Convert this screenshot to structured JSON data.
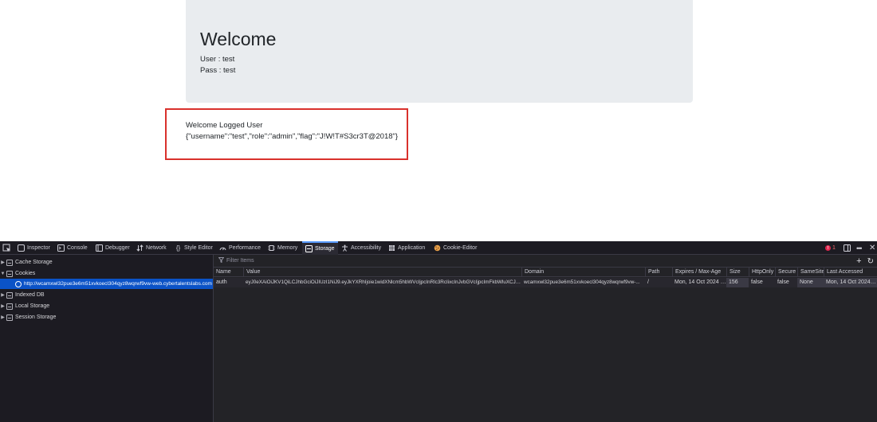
{
  "page": {
    "heading": "Welcome",
    "user_line": "User : test",
    "pass_line": "Pass : test",
    "result_title": "Welcome Logged User",
    "result_json": "{\"username\":\"test\",\"role\":\"admin\",\"flag\":\"J!W!T#S3cr3T@2018\"}"
  },
  "devtools": {
    "tabs": [
      {
        "label": "Inspector",
        "icon": "inspector-icon"
      },
      {
        "label": "Console",
        "icon": "console-icon"
      },
      {
        "label": "Debugger",
        "icon": "debugger-icon"
      },
      {
        "label": "Network",
        "icon": "network-icon"
      },
      {
        "label": "Style Editor",
        "icon": "style-editor-icon"
      },
      {
        "label": "Performance",
        "icon": "performance-icon"
      },
      {
        "label": "Memory",
        "icon": "memory-icon"
      },
      {
        "label": "Storage",
        "icon": "storage-icon"
      },
      {
        "label": "Accessibility",
        "icon": "accessibility-icon"
      },
      {
        "label": "Application",
        "icon": "application-icon"
      },
      {
        "label": "Cookie-Editor",
        "icon": "cookie-icon"
      }
    ],
    "selected_tab": "Storage",
    "error_count": "1",
    "sidebar": {
      "cache_storage": "Cache Storage",
      "cookies": "Cookies",
      "cookie_host": "http://wcamxwl32pue3e6m51xvkoecl304qyz8wqrwf9vw-web.cybertalentslabs.com",
      "indexed_db": "Indexed DB",
      "local_storage": "Local Storage",
      "session_storage": "Session Storage"
    },
    "filter_placeholder": "Filter Items",
    "columns": [
      "Name",
      "Value",
      "Domain",
      "Path",
      "Expires / Max-Age",
      "Size",
      "HttpOnly",
      "Secure",
      "SameSite",
      "Last Accessed"
    ],
    "rows": [
      {
        "name": "auth",
        "value": "eyJ0eXAiOiJKV1QiLCJhbGciOiJIUzI1NiJ9.eyJkYXRhIjoie1widXNlcm5hbWVcIjpcInRlc3RcIixcInJvbGVcIjpcImFkbWluXCJ9I...",
        "domain": "wcamxwl32pue3e6m51xvkoecl304qyz8wqrwf9vw-...",
        "path": "/",
        "expires": "Mon, 14 Oct 2024 0...",
        "size": "156",
        "httponly": "false",
        "secure": "false",
        "samesite": "None",
        "last_accessed": "Mon, 14 Oct 2024 0..."
      }
    ]
  }
}
